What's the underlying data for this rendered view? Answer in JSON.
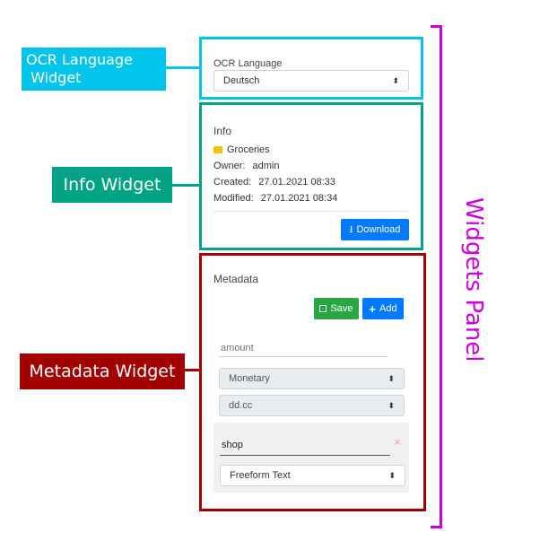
{
  "callouts": {
    "ocr": {
      "line1": "OCR Language",
      "line2": " Widget",
      "color": "#00c4ea"
    },
    "info": {
      "label": "Info Widget",
      "color": "#00a383"
    },
    "metadata": {
      "label": "Metadata Widget",
      "color": "#a30000"
    }
  },
  "panel": {
    "label": "Widgets Panel",
    "color": "#cc00dd"
  },
  "ocr_widget": {
    "label": "OCR Language",
    "select_value": "Deutsch"
  },
  "info_widget": {
    "title": "Info",
    "folder": "Groceries",
    "owner_label": "Owner:",
    "owner_value": "admin",
    "created_label": "Created:",
    "created_value": "27.01.2021 08:33",
    "modified_label": "Modified:",
    "modified_value": "27.01.2021 08:34",
    "download_label": "Download"
  },
  "metadata_widget": {
    "title": "Metadata",
    "save_label": "Save",
    "add_label": "Add",
    "field1": {
      "name_placeholder": "amount",
      "type_value": "Monetary",
      "format_value": "dd.cc"
    },
    "field2": {
      "name_value": "shop",
      "remove_glyph": "×",
      "type_value": "Freeform Text"
    }
  },
  "colors": {
    "save_green": "#28a745",
    "add_blue": "#007bff",
    "download_blue": "#007bff",
    "folder_yellow": "#f3c200"
  }
}
